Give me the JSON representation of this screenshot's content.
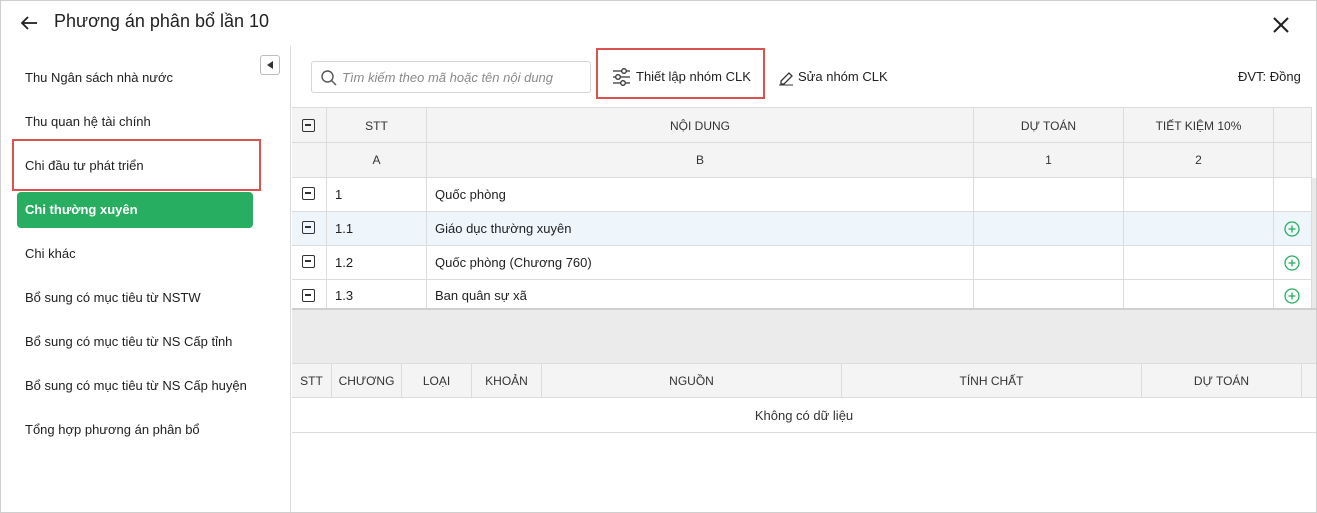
{
  "header": {
    "title": "Phương án phân bổ lần 10"
  },
  "sidebar": {
    "items": [
      {
        "label": "Thu Ngân sách nhà nước",
        "active": false
      },
      {
        "label": "Thu quan hệ tài chính",
        "active": false
      },
      {
        "label": "Chi đầu tư phát triển",
        "active": false
      },
      {
        "label": "Chi thường xuyên",
        "active": true
      },
      {
        "label": "Chi khác",
        "active": false
      },
      {
        "label": "Bổ sung có mục tiêu từ NSTW",
        "active": false
      },
      {
        "label": "Bổ sung có mục tiêu từ NS Cấp tỉnh",
        "active": false
      },
      {
        "label": "Bổ sung có mục tiêu từ NS Cấp huyện",
        "active": false
      },
      {
        "label": "Tổng hợp phương án phân bổ",
        "active": false
      }
    ]
  },
  "toolbar": {
    "search_placeholder": "Tìm kiếm theo mã hoặc tên nội dung",
    "setup_group_label": "Thiết lập nhóm CLK",
    "edit_group_label": "Sửa nhóm CLK",
    "unit_label": "ĐVT: Đồng"
  },
  "top_table": {
    "headers": [
      "STT",
      "NỘI DUNG",
      "DỰ TOÁN",
      "TIẾT KIỆM 10%"
    ],
    "index_row": [
      "A",
      "B",
      "1",
      "2"
    ],
    "rows": [
      {
        "stt": "1",
        "content": "Quốc phòng",
        "du_toan": "",
        "tiet_kiem": "",
        "has_add": false,
        "highlight": false
      },
      {
        "stt": "1.1",
        "content": "Giáo dục thường xuyên",
        "du_toan": "",
        "tiet_kiem": "",
        "has_add": true,
        "highlight": true
      },
      {
        "stt": "1.2",
        "content": "Quốc phòng (Chương 760)",
        "du_toan": "",
        "tiet_kiem": "",
        "has_add": true,
        "highlight": false
      },
      {
        "stt": "1.3",
        "content": "Ban quân sự xã",
        "du_toan": "",
        "tiet_kiem": "",
        "has_add": true,
        "highlight": false
      }
    ]
  },
  "bottom_table": {
    "headers": [
      "STT",
      "CHƯƠNG",
      "LOẠI",
      "KHOẢN",
      "NGUỒN",
      "TÍNH CHẤT",
      "DỰ TOÁN"
    ],
    "empty_text": "Không có dữ liệu"
  },
  "colors": {
    "active_green": "#27ae60",
    "highlight_red": "#d9534f",
    "add_icon_green": "#27ae60",
    "row_highlight": "#eef6fc"
  },
  "icons": [
    "back-arrow-icon",
    "close-icon",
    "collapse-left-icon",
    "search-icon",
    "sliders-icon",
    "pencil-icon",
    "minus-square-icon",
    "plus-circle-icon"
  ]
}
